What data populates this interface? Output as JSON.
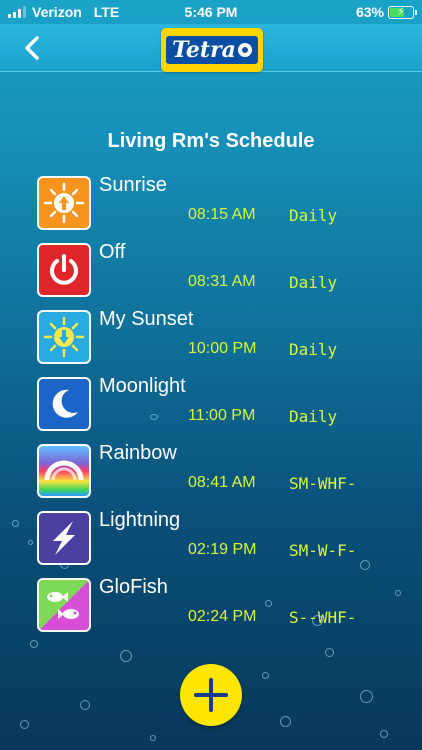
{
  "status_bar": {
    "carrier": "Verizon",
    "network": "LTE",
    "time": "5:46 PM",
    "battery": "63%",
    "battery_level": 0.63
  },
  "nav": {
    "back_icon": "chevron-left-icon",
    "logo_text": "Tetra"
  },
  "page": {
    "title": "Living Rm's Schedule"
  },
  "schedule": [
    {
      "name": "Sunrise",
      "time": "08:15 AM",
      "days": "Daily",
      "icon": "sunrise-icon",
      "color": "#f7941d"
    },
    {
      "name": "Off",
      "time": "08:31 AM",
      "days": "Daily",
      "icon": "power-icon",
      "color": "#e0262b"
    },
    {
      "name": "My Sunset",
      "time": "10:00 PM",
      "days": "Daily",
      "icon": "sunset-icon",
      "color": "#29abe2"
    },
    {
      "name": "Moonlight",
      "time": "11:00 PM",
      "days": "Daily",
      "icon": "moon-icon",
      "color": "#1c64c8"
    },
    {
      "name": "Rainbow",
      "time": "08:41 AM",
      "days": "SM-WHF-",
      "icon": "rainbow-icon",
      "color": "#ff3b6b"
    },
    {
      "name": "Lightning",
      "time": "02:19 PM",
      "days": "SM-W-F-",
      "icon": "lightning-icon",
      "color": "#4b3fa0"
    },
    {
      "name": "GloFish",
      "time": "02:24 PM",
      "days": "S--WHF-",
      "icon": "glofish-icon",
      "color": "#7ed957"
    }
  ],
  "add_button": {
    "icon": "plus-icon",
    "color": "#ffe600"
  },
  "colors": {
    "accent_text": "#d8f53a",
    "header": "#1ba2cc"
  }
}
